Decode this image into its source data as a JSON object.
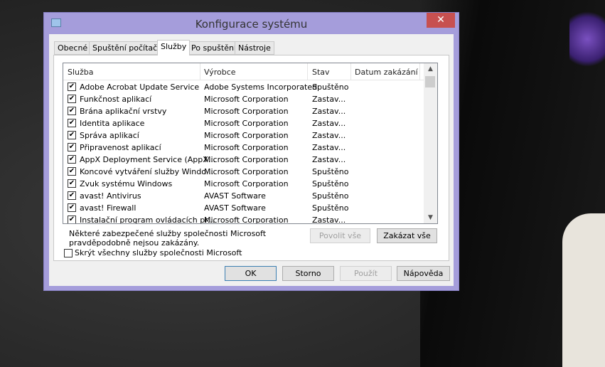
{
  "window": {
    "title": "Konfigurace systému",
    "close": "✕"
  },
  "tabs": [
    "Obecné",
    "Spuštění počítače",
    "Služby",
    "Po spuštění",
    "Nástroje"
  ],
  "active_tab": "Služby",
  "columns": [
    "Služba",
    "Výrobce",
    "Stav",
    "Datum zakázání"
  ],
  "rows": [
    {
      "name": "Adobe Acrobat Update Service",
      "vendor": "Adobe Systems Incorporated",
      "status": "Spuštěno",
      "checked": true
    },
    {
      "name": "Funkčnost aplikací",
      "vendor": "Microsoft Corporation",
      "status": "Zastav...",
      "checked": true
    },
    {
      "name": "Brána aplikační vrstvy",
      "vendor": "Microsoft Corporation",
      "status": "Zastav...",
      "checked": true
    },
    {
      "name": "Identita aplikace",
      "vendor": "Microsoft Corporation",
      "status": "Zastav...",
      "checked": true
    },
    {
      "name": "Správa aplikací",
      "vendor": "Microsoft Corporation",
      "status": "Zastav...",
      "checked": true
    },
    {
      "name": "Připravenost aplikací",
      "vendor": "Microsoft Corporation",
      "status": "Zastav...",
      "checked": true
    },
    {
      "name": "AppX Deployment Service (AppX...",
      "vendor": "Microsoft Corporation",
      "status": "Zastav...",
      "checked": true
    },
    {
      "name": "Koncové vytváření služby Windo...",
      "vendor": "Microsoft Corporation",
      "status": "Spuštěno",
      "checked": true
    },
    {
      "name": "Zvuk systému Windows",
      "vendor": "Microsoft Corporation",
      "status": "Spuštěno",
      "checked": true
    },
    {
      "name": "avast! Antivirus",
      "vendor": "AVAST Software",
      "status": "Spuštěno",
      "checked": true
    },
    {
      "name": "avast! Firewall",
      "vendor": "AVAST Software",
      "status": "Spuštěno",
      "checked": true
    },
    {
      "name": "Instalační program ovládacích pr...",
      "vendor": "Microsoft Corporation",
      "status": "Zastav...",
      "checked": true
    }
  ],
  "note": "Některé zabezpečené služby společnosti Microsoft pravděpodobně nejsou zakázány.",
  "enable_all": "Povolit vše",
  "disable_all": "Zakázat vše",
  "hide_ms": "Skrýt všechny služby společnosti Microsoft",
  "buttons": {
    "ok": "OK",
    "cancel": "Storno",
    "apply": "Použít",
    "help": "Nápověda"
  }
}
